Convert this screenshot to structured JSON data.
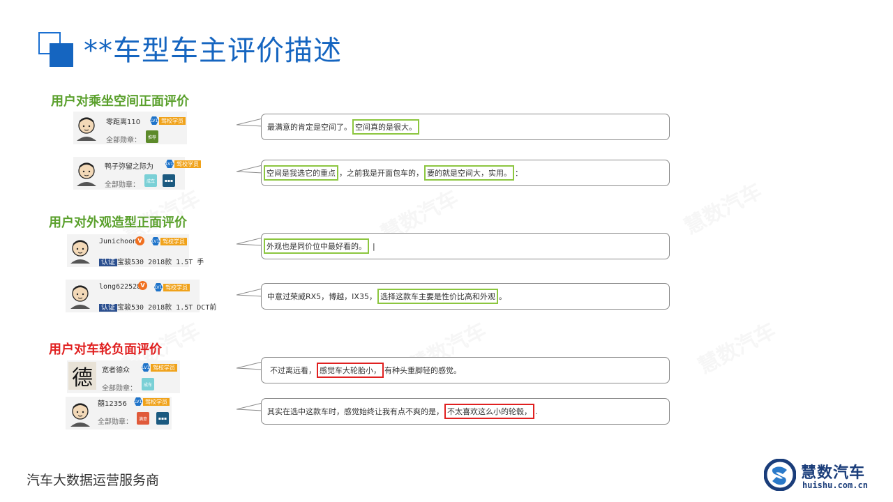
{
  "page_title": "**车型车主评价描述",
  "watermark": "慧数汽车",
  "footer": {
    "left": "汽车大数据运营服务商"
  },
  "brand": {
    "name": "慧数汽车",
    "url": "huishu.com.cn"
  },
  "level_badge": "LV1",
  "school_badge": "驾校学员",
  "medal_label": "全部勋章：",
  "cert_tag": "认证",
  "v_badge": "V",
  "sections": [
    {
      "title": "用户对乘坐空间正面评价"
    },
    {
      "title": "用户对外观造型正面评价"
    },
    {
      "title": "用户对车轮负面评价"
    }
  ],
  "users": [
    {
      "name": "零距离110",
      "medals": [
        "推荐"
      ]
    },
    {
      "name": "鸭子弥留之际为",
      "medals": [
        "成车",
        "▪▪▪"
      ]
    },
    {
      "name": "Junichoon",
      "cert": "宝骏530 2018款 1.5T 手"
    },
    {
      "name": "long622528",
      "cert": "宝骏530 2018款 1.5T DCT前"
    },
    {
      "name": "宽者德众",
      "avatar_char": "德",
      "medals": [
        "成车"
      ]
    },
    {
      "name": "囍12356",
      "medals": [
        "满意",
        "▪▪▪"
      ]
    }
  ],
  "comments": [
    {
      "pre": "最满意的肯定是空间了。",
      "hl1": "空间真的是很大。",
      "mid": "",
      "hl2": "",
      "post": ""
    },
    {
      "pre": "",
      "hl1": "空间是我选它的重点",
      "mid": "，之前我是开面包车的，",
      "hl2": "要的就是空间大，实用。",
      "post": "："
    },
    {
      "pre": "",
      "hl1": "外观也是同价位中最好看的。",
      "mid": "",
      "hl2": "",
      "post": "|"
    },
    {
      "pre": "中意过荣威RX5，博越，IX35，",
      "hl1": "选择这款车主要是性价比高和外观",
      "mid": "",
      "hl2": "",
      "post": "。"
    },
    {
      "pre": "不过离远看，",
      "hl1": "感觉车大轮胎小，",
      "mid": "",
      "hl2": "",
      "post": "有种头重脚轻的感觉。"
    },
    {
      "pre": "其实在选中这款车时，感觉始终让我有点不爽的是，",
      "hl1": "不太喜欢这么小的轮毂，",
      "mid": "",
      "hl2": "",
      "post": "."
    }
  ]
}
